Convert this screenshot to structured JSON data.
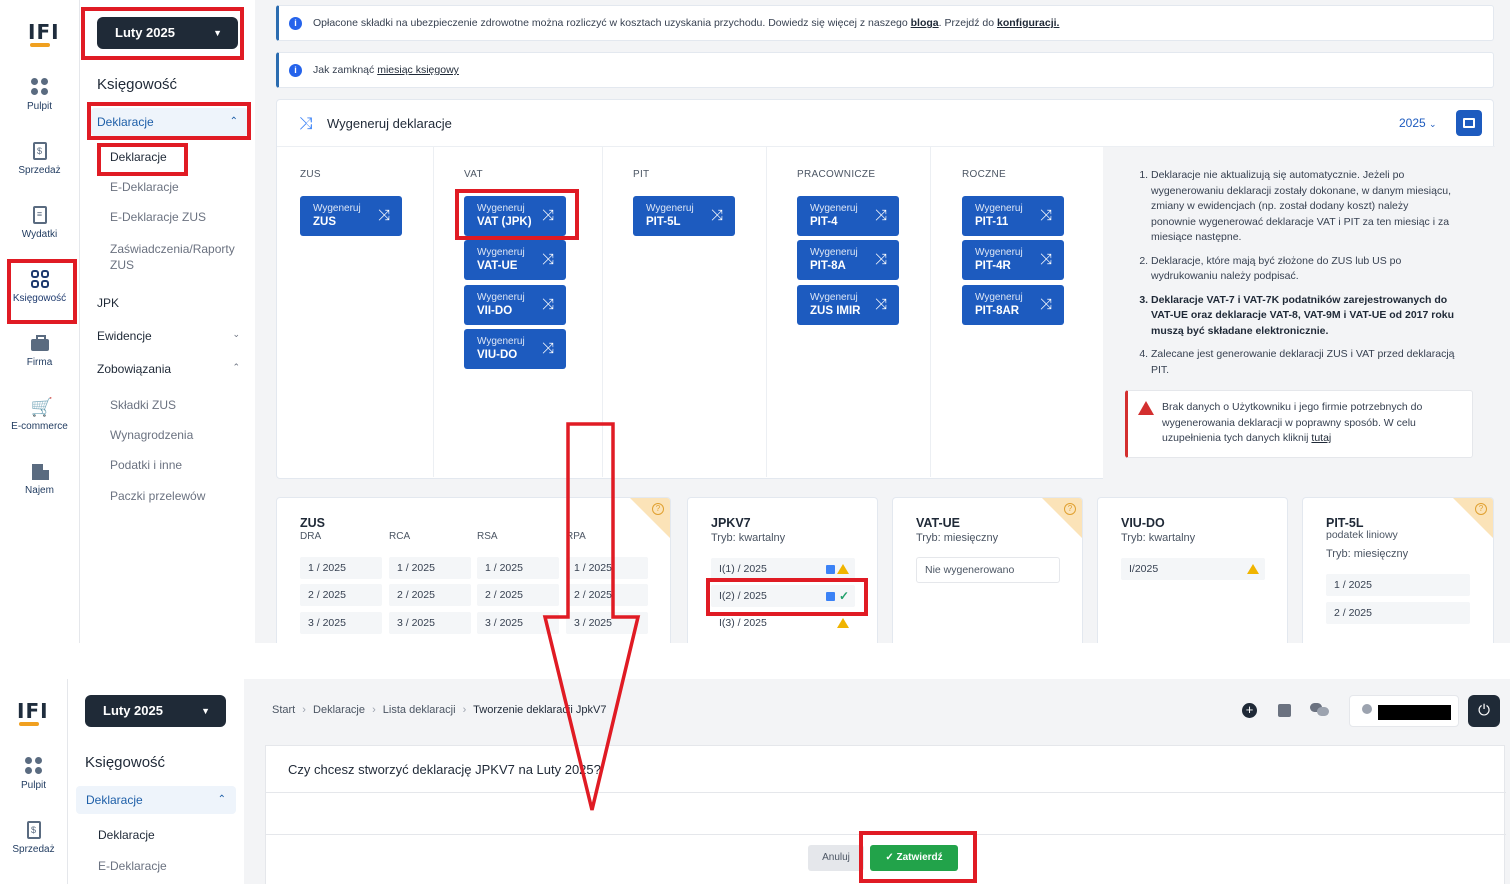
{
  "top": {
    "logo": "IFI",
    "month_selector": "Luty 2025",
    "rail": [
      {
        "label": "Pulpit",
        "icon": "dashboard-icon"
      },
      {
        "label": "Sprzedaż",
        "icon": "sales-document-icon"
      },
      {
        "label": "Wydatki",
        "icon": "expenses-document-icon"
      },
      {
        "label": "Księgowość",
        "icon": "accounting-grid-icon"
      },
      {
        "label": "Firma",
        "icon": "briefcase-icon"
      },
      {
        "label": "E-commerce",
        "icon": "cart-icon"
      },
      {
        "label": "Najem",
        "icon": "building-icon"
      }
    ],
    "menu": {
      "title": "Księgowość",
      "active_group": "Deklaracje",
      "deklaracje_items": [
        "Deklaracje",
        "E-Deklaracje",
        "E-Deklaracje ZUS",
        "Zaświadczenia/Raporty ZUS"
      ],
      "jpk": "JPK",
      "ewidencje": "Ewidencje",
      "zobowiazania": "Zobowiązania",
      "zobowiazania_items": [
        "Składki ZUS",
        "Wynagrodzenia",
        "Podatki i inne",
        "Paczki przelewów"
      ]
    },
    "banner1": {
      "text": "Opłacone składki na ubezpieczenie zdrowotne można rozliczyć w kosztach uzyskania przychodu. Dowiedz się więcej z naszego ",
      "link1": "bloga",
      "mid": ". Przejdź do ",
      "link2": "konfiguracji."
    },
    "banner2": {
      "text": "Jak zamknąć ",
      "link": "miesiąc księgowy"
    },
    "generator": {
      "title": "Wygeneruj deklaracje",
      "year": "2025",
      "columns": [
        {
          "head": "ZUS",
          "buttons": [
            {
              "l1": "Wygeneruj",
              "l2": "ZUS"
            }
          ]
        },
        {
          "head": "VAT",
          "buttons": [
            {
              "l1": "Wygeneruj",
              "l2": "VAT (JPK)"
            },
            {
              "l1": "Wygeneruj",
              "l2": "VAT-UE"
            },
            {
              "l1": "Wygeneruj",
              "l2": "VII-DO"
            },
            {
              "l1": "Wygeneruj",
              "l2": "VIU-DO"
            }
          ]
        },
        {
          "head": "PIT",
          "buttons": [
            {
              "l1": "Wygeneruj",
              "l2": "PIT-5L"
            }
          ]
        },
        {
          "head": "PRACOWNICZE",
          "buttons": [
            {
              "l1": "Wygeneruj",
              "l2": "PIT-4"
            },
            {
              "l1": "Wygeneruj",
              "l2": "PIT-8A"
            },
            {
              "l1": "Wygeneruj",
              "l2": "ZUS IMIR"
            }
          ]
        },
        {
          "head": "ROCZNE",
          "buttons": [
            {
              "l1": "Wygeneruj",
              "l2": "PIT-11"
            },
            {
              "l1": "Wygeneruj",
              "l2": "PIT-4R"
            },
            {
              "l1": "Wygeneruj",
              "l2": "PIT-8AR"
            }
          ]
        }
      ],
      "notes": [
        "Deklaracje nie aktualizują się automatycznie. Jeżeli po wygenerowaniu deklaracji zostały dokonane, w danym miesiącu, zmiany w ewidencjach (np. został dodany koszt) należy ponownie wygenerować deklaracje VAT i PIT za ten miesiąc i za miesiące następne.",
        "Deklaracje, które mają być złożone do ZUS lub US po wydrukowaniu należy podpisać.",
        "Deklaracje VAT-7 i VAT-7K podatników zarejestrowanych do VAT-UE oraz deklaracje VAT-8, VAT-9M i VAT-UE od 2017 roku muszą być składane elektronicznie.",
        "Zalecane jest generowanie deklaracji ZUS i VAT przed deklaracją PIT."
      ],
      "warning": {
        "text": "Brak danych o Użytkowniku i jego firmie potrzebnych do wygenerowania deklaracji w poprawny sposób. W celu uzupełnienia tych danych kliknij ",
        "link": "tutaj"
      }
    },
    "cards": {
      "zus": {
        "title": "ZUS",
        "cols": [
          "DRA",
          "RCA",
          "RSA",
          "RPA"
        ],
        "rows": [
          [
            "1 / 2025",
            "1 / 2025",
            "1 / 2025",
            "1 / 2025"
          ],
          [
            "2 / 2025",
            "2 / 2025",
            "2 / 2025",
            "2 / 2025"
          ],
          [
            "3 / 2025",
            "3 / 2025",
            "3 / 2025",
            "3 / 2025"
          ]
        ]
      },
      "jpkv7": {
        "title": "JPKV7",
        "mode_label": "Tryb:",
        "mode": "kwartalny",
        "rows": [
          "I(1) / 2025",
          "I(2) / 2025",
          "I(3) / 2025"
        ]
      },
      "vatue": {
        "title": "VAT-UE",
        "mode_label": "Tryb:",
        "mode": "miesięczny",
        "empty": "Nie wygenerowano"
      },
      "viudo": {
        "title": "VIU-DO",
        "mode_label": "Tryb:",
        "mode": "kwartalny",
        "rows": [
          "I/2025"
        ]
      },
      "pit5l": {
        "title": "PIT-5L",
        "subtitle": "podatek liniowy",
        "mode_label": "Tryb:",
        "mode": "miesięczny",
        "rows": [
          "1 / 2025",
          "2 / 2025"
        ]
      }
    }
  },
  "bottom": {
    "logo": "IFI",
    "month_selector": "Luty 2025",
    "rail": [
      {
        "label": "Pulpit"
      },
      {
        "label": "Sprzedaż"
      }
    ],
    "menu": {
      "title": "Księgowość",
      "active_group": "Deklaracje",
      "items": [
        "Deklaracje",
        "E-Deklaracje"
      ]
    },
    "breadcrumb": [
      "Start",
      "Deklaracje",
      "Lista deklaracji",
      "Tworzenie deklaracji JpkV7"
    ],
    "question": "Czy chcesz stworzyć deklarację JPKV7 na Luty 2025?",
    "cancel": "Anuluj",
    "confirm": "Zatwierdź"
  },
  "colors": {
    "accent": "#1d5bbf",
    "highlight": "#e01b24",
    "confirm": "#22a34a",
    "dark": "#1f2a37"
  }
}
